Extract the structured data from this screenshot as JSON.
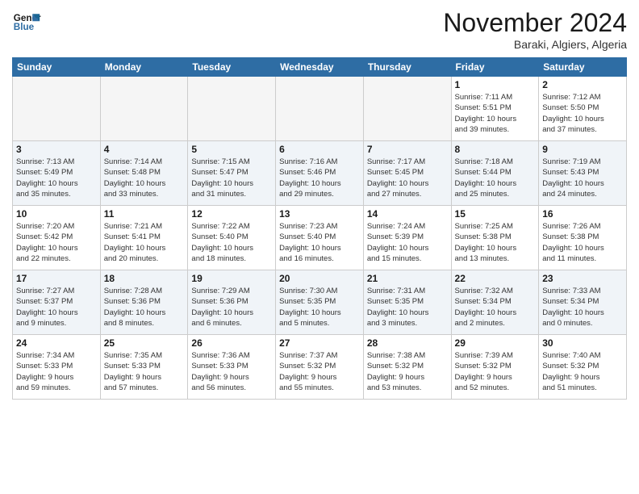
{
  "logo": {
    "line1": "General",
    "line2": "Blue"
  },
  "header": {
    "month": "November 2024",
    "location": "Baraki, Algiers, Algeria"
  },
  "weekdays": [
    "Sunday",
    "Monday",
    "Tuesday",
    "Wednesday",
    "Thursday",
    "Friday",
    "Saturday"
  ],
  "weeks": [
    [
      {
        "day": "",
        "info": ""
      },
      {
        "day": "",
        "info": ""
      },
      {
        "day": "",
        "info": ""
      },
      {
        "day": "",
        "info": ""
      },
      {
        "day": "",
        "info": ""
      },
      {
        "day": "1",
        "info": "Sunrise: 7:11 AM\nSunset: 5:51 PM\nDaylight: 10 hours\nand 39 minutes."
      },
      {
        "day": "2",
        "info": "Sunrise: 7:12 AM\nSunset: 5:50 PM\nDaylight: 10 hours\nand 37 minutes."
      }
    ],
    [
      {
        "day": "3",
        "info": "Sunrise: 7:13 AM\nSunset: 5:49 PM\nDaylight: 10 hours\nand 35 minutes."
      },
      {
        "day": "4",
        "info": "Sunrise: 7:14 AM\nSunset: 5:48 PM\nDaylight: 10 hours\nand 33 minutes."
      },
      {
        "day": "5",
        "info": "Sunrise: 7:15 AM\nSunset: 5:47 PM\nDaylight: 10 hours\nand 31 minutes."
      },
      {
        "day": "6",
        "info": "Sunrise: 7:16 AM\nSunset: 5:46 PM\nDaylight: 10 hours\nand 29 minutes."
      },
      {
        "day": "7",
        "info": "Sunrise: 7:17 AM\nSunset: 5:45 PM\nDaylight: 10 hours\nand 27 minutes."
      },
      {
        "day": "8",
        "info": "Sunrise: 7:18 AM\nSunset: 5:44 PM\nDaylight: 10 hours\nand 25 minutes."
      },
      {
        "day": "9",
        "info": "Sunrise: 7:19 AM\nSunset: 5:43 PM\nDaylight: 10 hours\nand 24 minutes."
      }
    ],
    [
      {
        "day": "10",
        "info": "Sunrise: 7:20 AM\nSunset: 5:42 PM\nDaylight: 10 hours\nand 22 minutes."
      },
      {
        "day": "11",
        "info": "Sunrise: 7:21 AM\nSunset: 5:41 PM\nDaylight: 10 hours\nand 20 minutes."
      },
      {
        "day": "12",
        "info": "Sunrise: 7:22 AM\nSunset: 5:40 PM\nDaylight: 10 hours\nand 18 minutes."
      },
      {
        "day": "13",
        "info": "Sunrise: 7:23 AM\nSunset: 5:40 PM\nDaylight: 10 hours\nand 16 minutes."
      },
      {
        "day": "14",
        "info": "Sunrise: 7:24 AM\nSunset: 5:39 PM\nDaylight: 10 hours\nand 15 minutes."
      },
      {
        "day": "15",
        "info": "Sunrise: 7:25 AM\nSunset: 5:38 PM\nDaylight: 10 hours\nand 13 minutes."
      },
      {
        "day": "16",
        "info": "Sunrise: 7:26 AM\nSunset: 5:38 PM\nDaylight: 10 hours\nand 11 minutes."
      }
    ],
    [
      {
        "day": "17",
        "info": "Sunrise: 7:27 AM\nSunset: 5:37 PM\nDaylight: 10 hours\nand 9 minutes."
      },
      {
        "day": "18",
        "info": "Sunrise: 7:28 AM\nSunset: 5:36 PM\nDaylight: 10 hours\nand 8 minutes."
      },
      {
        "day": "19",
        "info": "Sunrise: 7:29 AM\nSunset: 5:36 PM\nDaylight: 10 hours\nand 6 minutes."
      },
      {
        "day": "20",
        "info": "Sunrise: 7:30 AM\nSunset: 5:35 PM\nDaylight: 10 hours\nand 5 minutes."
      },
      {
        "day": "21",
        "info": "Sunrise: 7:31 AM\nSunset: 5:35 PM\nDaylight: 10 hours\nand 3 minutes."
      },
      {
        "day": "22",
        "info": "Sunrise: 7:32 AM\nSunset: 5:34 PM\nDaylight: 10 hours\nand 2 minutes."
      },
      {
        "day": "23",
        "info": "Sunrise: 7:33 AM\nSunset: 5:34 PM\nDaylight: 10 hours\nand 0 minutes."
      }
    ],
    [
      {
        "day": "24",
        "info": "Sunrise: 7:34 AM\nSunset: 5:33 PM\nDaylight: 9 hours\nand 59 minutes."
      },
      {
        "day": "25",
        "info": "Sunrise: 7:35 AM\nSunset: 5:33 PM\nDaylight: 9 hours\nand 57 minutes."
      },
      {
        "day": "26",
        "info": "Sunrise: 7:36 AM\nSunset: 5:33 PM\nDaylight: 9 hours\nand 56 minutes."
      },
      {
        "day": "27",
        "info": "Sunrise: 7:37 AM\nSunset: 5:32 PM\nDaylight: 9 hours\nand 55 minutes."
      },
      {
        "day": "28",
        "info": "Sunrise: 7:38 AM\nSunset: 5:32 PM\nDaylight: 9 hours\nand 53 minutes."
      },
      {
        "day": "29",
        "info": "Sunrise: 7:39 AM\nSunset: 5:32 PM\nDaylight: 9 hours\nand 52 minutes."
      },
      {
        "day": "30",
        "info": "Sunrise: 7:40 AM\nSunset: 5:32 PM\nDaylight: 9 hours\nand 51 minutes."
      }
    ]
  ]
}
